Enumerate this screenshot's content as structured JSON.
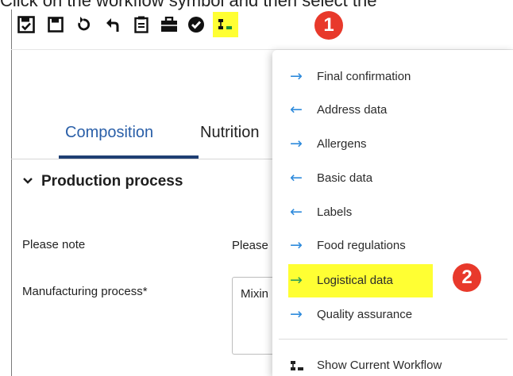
{
  "instruction": "Click on the workflow symbol and then select the",
  "colors": {
    "accent": "#2a5fa8",
    "tab_underline": "#1f3f73",
    "highlight": "#ffff33",
    "callout": "#e8392b",
    "arrow_blue": "#2f8bdc",
    "arrow_green": "#2f9e5a"
  },
  "toolbar": {
    "icons": [
      {
        "name": "save-check-icon"
      },
      {
        "name": "save-icon"
      },
      {
        "name": "undo-icon"
      },
      {
        "name": "back-icon"
      },
      {
        "name": "document-icon"
      },
      {
        "name": "briefcase-icon"
      },
      {
        "name": "check-circle-icon"
      },
      {
        "name": "workflow-icon",
        "highlighted": true
      }
    ]
  },
  "callouts": {
    "one": "1",
    "two": "2"
  },
  "tabs": [
    {
      "label": "Composition",
      "active": true
    },
    {
      "label": "Nutrition",
      "active": false
    }
  ],
  "section": {
    "title": "Production process",
    "expanded": true
  },
  "fields": {
    "please_note": {
      "label": "Please note",
      "value": "Please"
    },
    "manufacturing": {
      "label": "Manufacturing process*",
      "value": "Mixin"
    }
  },
  "workflow_menu": {
    "items": [
      {
        "label": "Final confirmation",
        "direction": "forward",
        "icon": "arrow-right-icon"
      },
      {
        "label": "Address data",
        "direction": "back",
        "icon": "arrow-left-icon"
      },
      {
        "label": "Allergens",
        "direction": "forward",
        "icon": "arrow-right-icon"
      },
      {
        "label": "Basic data",
        "direction": "back",
        "icon": "arrow-left-icon"
      },
      {
        "label": "Labels",
        "direction": "back",
        "icon": "arrow-left-icon"
      },
      {
        "label": "Food regulations",
        "direction": "forward",
        "icon": "arrow-right-icon"
      },
      {
        "label": "Logistical data",
        "direction": "forward",
        "icon": "arrow-right-icon",
        "highlighted": true
      },
      {
        "label": "Quality assurance",
        "direction": "forward",
        "icon": "arrow-right-icon"
      }
    ],
    "show_workflow_label": "Show Current Workflow"
  }
}
